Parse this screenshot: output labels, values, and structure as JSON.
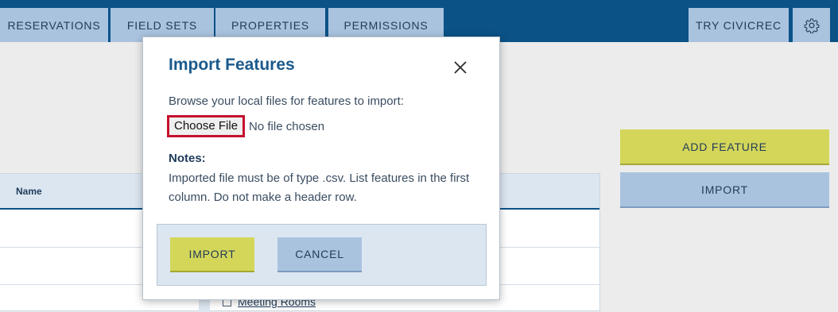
{
  "nav": {
    "tabs": [
      {
        "label": "RESERVATIONS"
      },
      {
        "label": "FIELD SETS"
      },
      {
        "label": "PROPERTIES"
      },
      {
        "label": "PERMISSIONS"
      }
    ],
    "try_label": "TRY CIVICREC",
    "settings_icon": "gear-icon"
  },
  "table": {
    "column_name": "Name",
    "visible_item": "Meeting Rooms"
  },
  "side_actions": {
    "add_feature": "ADD FEATURE",
    "import": "IMPORT"
  },
  "modal": {
    "title": "Import Features",
    "close_icon": "close-icon",
    "browse_text": "Browse your local files for features to import:",
    "choose_file_label": "Choose File",
    "no_file_text": "No file chosen",
    "notes_label": "Notes:",
    "notes_text": "Imported file must be of type .csv. List features in the first column. Do not make a header row.",
    "import_button": "IMPORT",
    "cancel_button": "CANCEL"
  },
  "colors": {
    "nav_bg": "#0b5287",
    "tab_bg": "#a9c3df",
    "accent_yellow": "#d4d65a",
    "highlight_red": "#c5102e"
  }
}
